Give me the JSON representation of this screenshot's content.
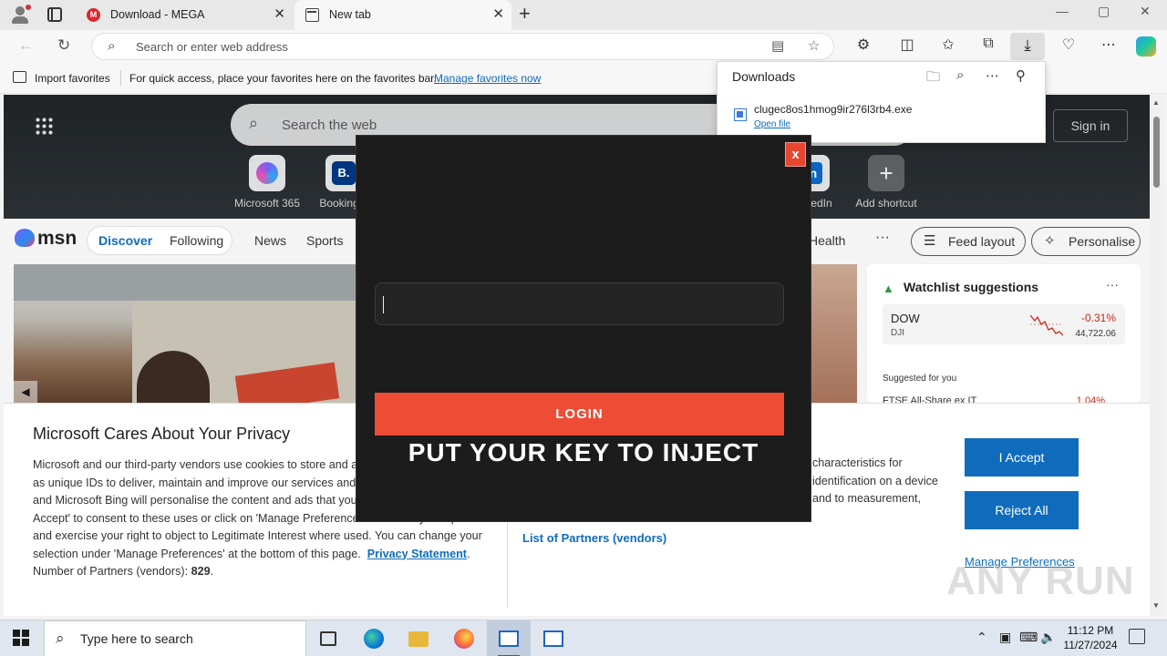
{
  "browser": {
    "tabs": [
      {
        "title": "Download - MEGA",
        "favicon": "mega-icon"
      },
      {
        "title": "New tab",
        "favicon": "newtab-icon"
      }
    ],
    "new_tab_glyph": "+",
    "close_glyph": "✕",
    "window_controls": {
      "minimize": "—",
      "maximize": "▢",
      "close": "✕"
    },
    "address_placeholder": "Search or enter web address"
  },
  "favorites_bar": {
    "import_label": "Import favorites",
    "message": "For quick access, place your favorites here on the favorites bar.",
    "manage_link": "Manage favorites now"
  },
  "downloads": {
    "title": "Downloads",
    "file_name": "clugec8os1hmog9ir276l3rb4.exe",
    "open_link": "Open file"
  },
  "newtab": {
    "search_placeholder": "Search the web",
    "sign_in": "Sign in",
    "shortcuts": [
      {
        "label": "Microsoft 365",
        "glyph": ""
      },
      {
        "label": "Booking...",
        "glyph": "B."
      },
      {
        "label": "LinkedIn",
        "glyph": "in"
      },
      {
        "label": "Add shortcut",
        "glyph": "+"
      }
    ],
    "msn_logo": "msn",
    "nav": {
      "discover": "Discover",
      "following": "Following",
      "news": "News",
      "sports": "Sports",
      "health": "Health",
      "more": "···"
    },
    "feed_layout": "Feed layout",
    "personalise": "Personalise",
    "watchlist": {
      "title": "Watchlist suggestions",
      "more": "···",
      "stock": {
        "symbol": "DOW",
        "sub": "DJI",
        "change": "-0.31%",
        "value": "44,722.06"
      },
      "suggested_label": "Suggested for you",
      "next_item": "FTSE All-Share ex IT",
      "next_change": "1.04%"
    }
  },
  "privacy": {
    "heading": "Microsoft Cares About Your Privacy",
    "body": "Microsoft and our third-party vendors use cookies to store and access information such as unique IDs to deliver, maintain and improve our services and ads. If you agree, MSN and Microsoft Bing will personalise the content and ads that you see. You can select 'I Accept' to consent to these uses or click on 'Manage Preferences' to review your options and exercise your right to object to Legitimate Interest where used.  You can change your selection under 'Manage Preferences' at the bottom of this page.",
    "privacy_link": "Privacy Statement",
    "partners_count_label": "Number of Partners (vendors):",
    "partners_count": "829",
    "right_text": "characteristics for identification on a device and to measurement,",
    "partners_link": "List of Partners (vendors)",
    "accept": "I Accept",
    "reject": "Reject All",
    "manage": "Manage Preferences"
  },
  "popup": {
    "close": "x",
    "key_value": "",
    "login": "LOGIN",
    "headline": "PUT YOUR KEY TO INJECT"
  },
  "watermark": "ANY RUN",
  "taskbar": {
    "search_placeholder": "Type here to search",
    "time": "11:12 PM",
    "date": "11/27/2024"
  }
}
